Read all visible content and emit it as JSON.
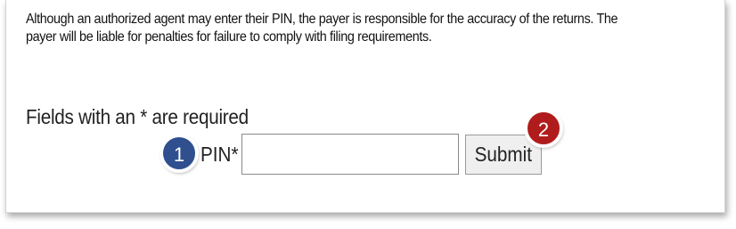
{
  "notice": {
    "line1": "Although an authorized agent may enter their PIN, the payer is responsible for the accuracy of the returns.  The",
    "line2": "payer will be liable for penalties for failure to comply with filing requirements."
  },
  "form": {
    "required_note": "Fields with an * are required",
    "pin_label": "PIN*",
    "pin_value": "",
    "submit_label": "Submit"
  },
  "callouts": {
    "badge1": "1",
    "badge2": "2",
    "badge1_color": "#2f4f8f",
    "badge2_color": "#b01c1c"
  }
}
